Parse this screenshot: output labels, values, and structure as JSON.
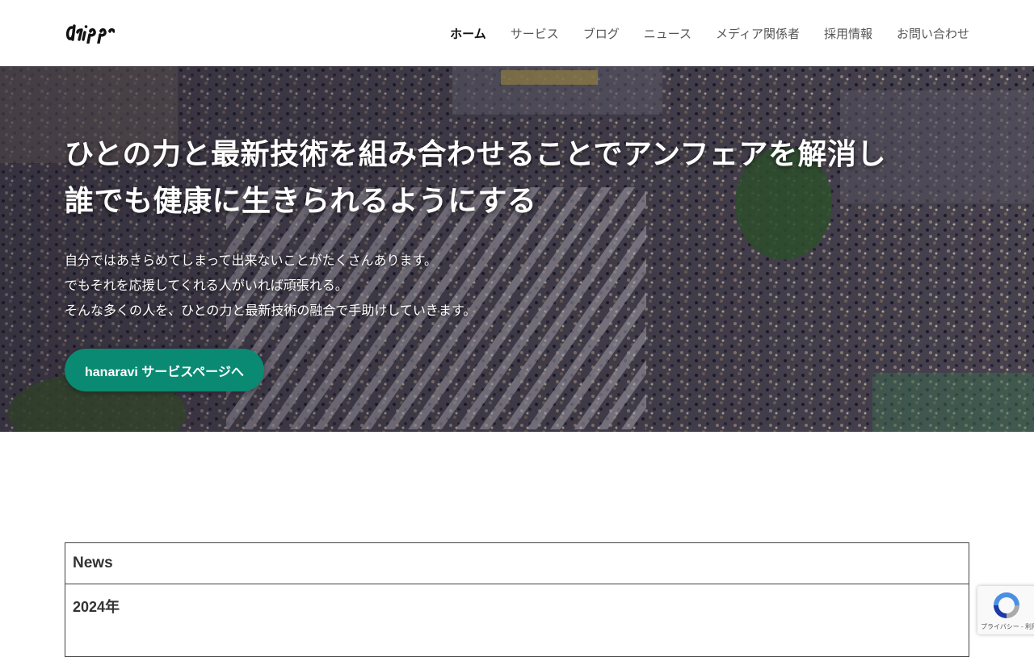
{
  "header": {
    "logo_text": "dripp",
    "nav": [
      {
        "label": "ホーム",
        "active": true
      },
      {
        "label": "サービス"
      },
      {
        "label": "ブログ"
      },
      {
        "label": "ニュース"
      },
      {
        "label": "メディア関係者"
      },
      {
        "label": "採用情報"
      },
      {
        "label": "お問い合わせ"
      }
    ]
  },
  "hero": {
    "title_line1": "ひとの力と最新技術を組み合わせることでアンフェアを解消し",
    "title_line2": "誰でも健康に生きられるようにする",
    "text_line1": "自分ではあきらめてしまって出来ないことがたくさんあります。",
    "text_line2": "でもそれを応援してくれる人がいれば頑張れる。",
    "text_line3": "そんな多くの人を、ひとの力と最新技術の融合で手助けしていきます。",
    "cta_label": "hanaravi サービスページへ",
    "cta_color": "#0a8a73"
  },
  "news": {
    "heading": "News",
    "year": "2024年"
  },
  "recaptcha": {
    "icon": "recaptcha-icon",
    "terms": "プライバシー - 利用規約"
  }
}
